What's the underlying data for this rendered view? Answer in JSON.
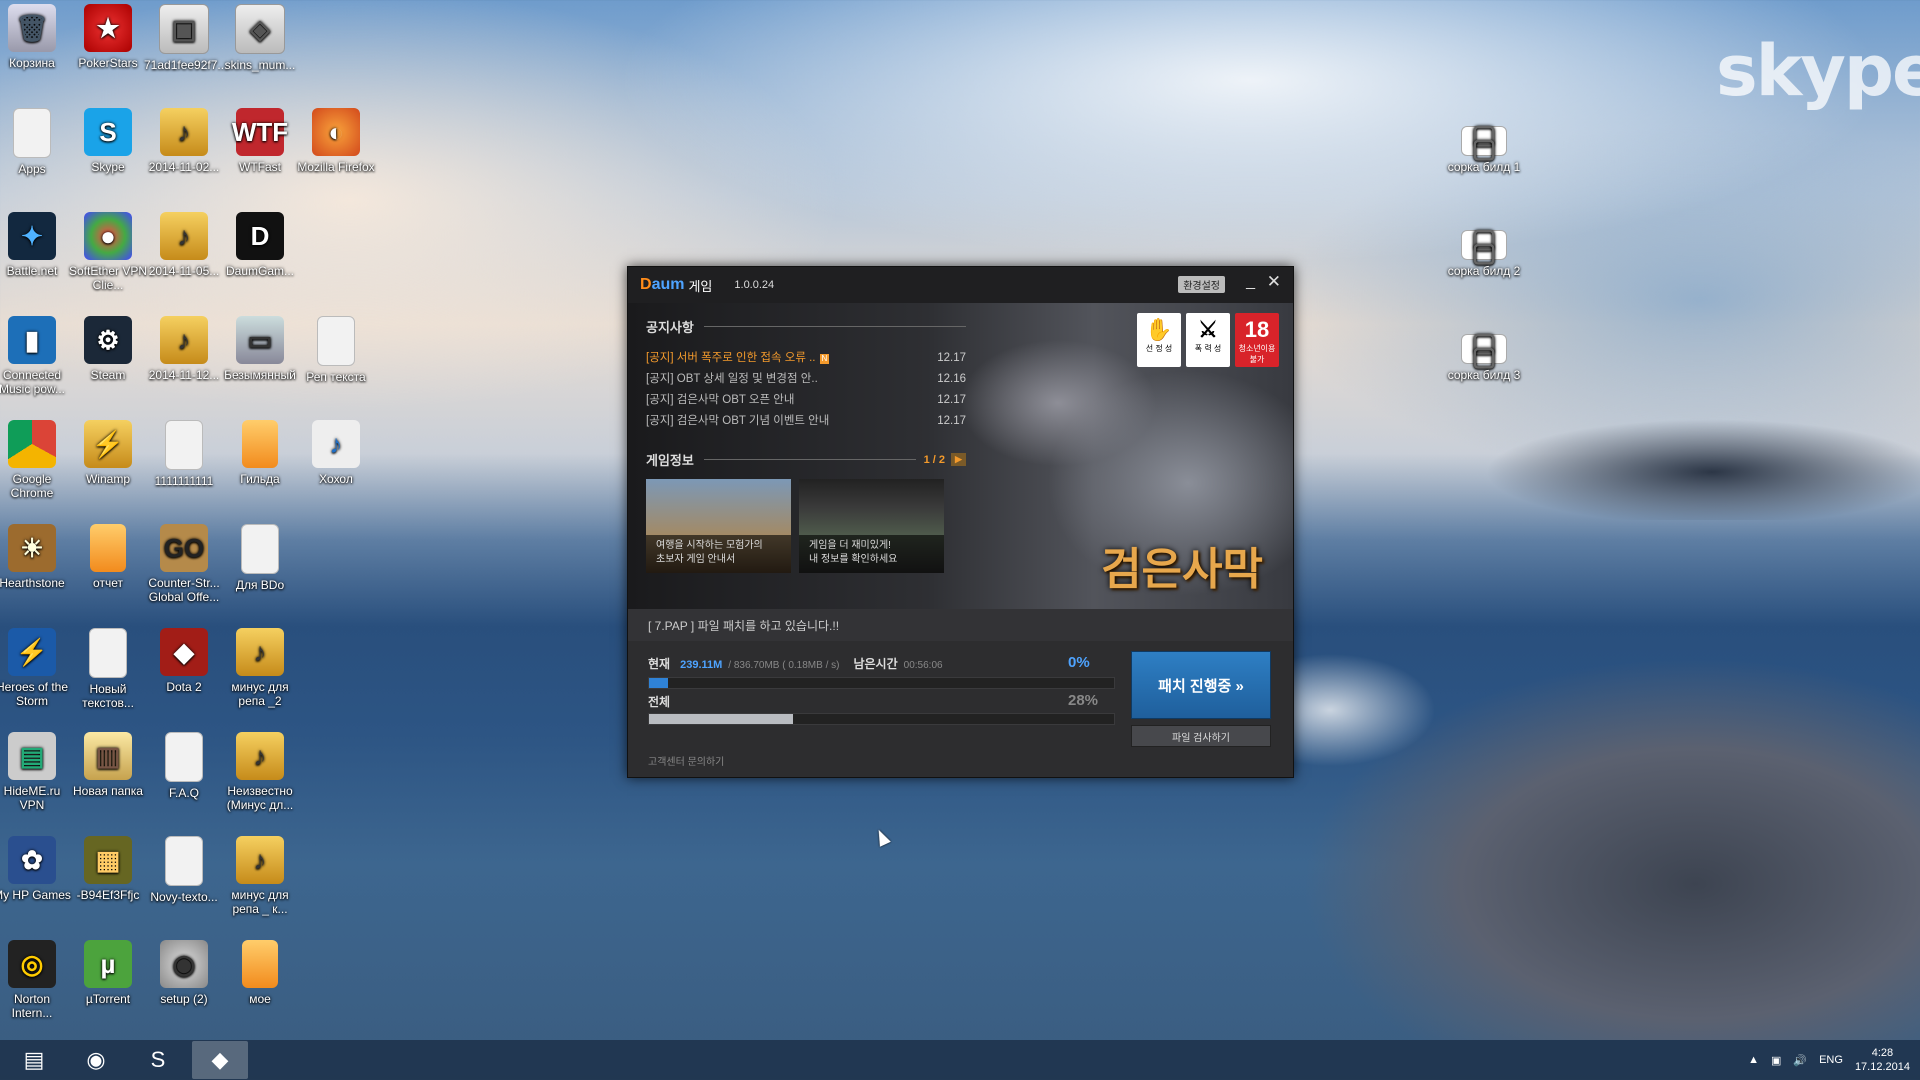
{
  "desktop": {
    "icons": [
      {
        "label": "Корзина",
        "glyph": "🗑",
        "cls": "g-bin",
        "name": "recycle-bin-icon"
      },
      {
        "label": "PokerStars",
        "glyph": "★",
        "cls": "g-star",
        "name": "pokerstars-icon"
      },
      {
        "label": "71ad1fee92f7...",
        "glyph": "▣",
        "cls": "g-img",
        "name": "image-file-icon"
      },
      {
        "label": "skins_mum...",
        "glyph": "◈",
        "cls": "g-img",
        "name": "skins-file-icon"
      },
      {
        "label": "Apps",
        "glyph": "",
        "cls": "g-doc",
        "name": "apps-shortcut-icon"
      },
      {
        "label": "Skype",
        "glyph": "S",
        "cls": "g-skype",
        "name": "skype-icon"
      },
      {
        "label": "2014-11-02...",
        "glyph": "♪",
        "cls": "g-winamp",
        "name": "winamp-file-icon"
      },
      {
        "label": "WTFast",
        "glyph": "WTF",
        "cls": "g-wtf",
        "name": "wtfast-icon"
      },
      {
        "label": "Mozilla Firefox",
        "glyph": "◐",
        "cls": "g-ff",
        "name": "firefox-icon"
      },
      {
        "label": "Battle.net",
        "glyph": "✦",
        "cls": "g-bnet",
        "name": "battlenet-icon"
      },
      {
        "label": "SoftEther VPN Clie...",
        "glyph": "●",
        "cls": "g-se",
        "name": "softether-icon"
      },
      {
        "label": "2014-11-05...",
        "glyph": "♪",
        "cls": "g-winamp",
        "name": "winamp-file-icon"
      },
      {
        "label": "DaumGam...",
        "glyph": "D",
        "cls": "g-daum",
        "name": "daumgame-icon"
      },
      {
        "label": "Connected Music pow...",
        "glyph": "▮",
        "cls": "g-cm",
        "name": "connected-music-icon"
      },
      {
        "label": "Steam",
        "glyph": "⚙",
        "cls": "g-steam",
        "name": "steam-icon"
      },
      {
        "label": "2014-11-12...",
        "glyph": "♪",
        "cls": "g-winamp",
        "name": "winamp-file-icon"
      },
      {
        "label": "Безымянный",
        "glyph": "▭",
        "cls": "g-pic",
        "name": "picture-file-icon"
      },
      {
        "label": "Реп текста",
        "glyph": "",
        "cls": "g-doc",
        "name": "text-file-icon"
      },
      {
        "label": "Google Chrome",
        "glyph": "",
        "cls": "g-chrome",
        "name": "chrome-icon"
      },
      {
        "label": "Winamp",
        "glyph": "⚡",
        "cls": "g-winamp",
        "name": "winamp-icon"
      },
      {
        "label": "1111111111",
        "glyph": "",
        "cls": "g-doc",
        "name": "text-file-icon"
      },
      {
        "label": "Гильда",
        "glyph": "",
        "cls": "g-folder",
        "name": "archive-file-icon"
      },
      {
        "label": "Хохол",
        "glyph": "♪",
        "cls": "g-note",
        "name": "audio-file-icon"
      },
      {
        "label": "Hearthstone",
        "glyph": "☀",
        "cls": "g-hs",
        "name": "hearthstone-icon"
      },
      {
        "label": "отчет",
        "glyph": "",
        "cls": "g-folder",
        "name": "archive-file-icon"
      },
      {
        "label": "Counter-Str... Global Offe...",
        "glyph": "GO",
        "cls": "g-cs",
        "name": "csgo-icon"
      },
      {
        "label": "Для BDo",
        "glyph": "",
        "cls": "g-doc",
        "name": "text-file-icon"
      },
      {
        "label": "Heroes of the Storm",
        "glyph": "⚡",
        "cls": "g-hots",
        "name": "heroes-of-the-storm-icon"
      },
      {
        "label": "Новый текстов...",
        "glyph": "",
        "cls": "g-doc",
        "name": "text-file-icon"
      },
      {
        "label": "Dota 2",
        "glyph": "◆",
        "cls": "g-dota",
        "name": "dota2-icon"
      },
      {
        "label": "минус для репа _2",
        "glyph": "♪",
        "cls": "g-winamp",
        "name": "winamp-file-icon"
      },
      {
        "label": "HideME.ru VPN",
        "glyph": "▤",
        "cls": "g-hide",
        "name": "hideme-vpn-icon"
      },
      {
        "label": "Новая папка",
        "glyph": "▥",
        "cls": "g-newf",
        "name": "folder-icon"
      },
      {
        "label": "F.A.Q",
        "glyph": "",
        "cls": "g-doc",
        "name": "text-file-icon"
      },
      {
        "label": "Неизвестно (Минус дл...",
        "glyph": "♪",
        "cls": "g-winamp",
        "name": "winamp-file-icon"
      },
      {
        "label": "My HP Games",
        "glyph": "✿",
        "cls": "g-hp",
        "name": "hp-games-icon"
      },
      {
        "label": "-B94Ef3Ffjc",
        "glyph": "▦",
        "cls": "g-rar",
        "name": "archive-icon"
      },
      {
        "label": "Novy-texto...",
        "glyph": "",
        "cls": "g-doc",
        "name": "text-file-icon"
      },
      {
        "label": "минус для репа _ к...",
        "glyph": "♪",
        "cls": "g-winamp",
        "name": "winamp-file-icon"
      },
      {
        "label": "Norton Intern...",
        "glyph": "◎",
        "cls": "g-norton",
        "name": "norton-icon"
      },
      {
        "label": "µTorrent",
        "glyph": "µ",
        "cls": "g-ut",
        "name": "utorrent-icon"
      },
      {
        "label": "setup (2)",
        "glyph": "◉",
        "cls": "g-cd",
        "name": "setup-disc-icon"
      },
      {
        "label": "мое",
        "glyph": "",
        "cls": "g-folder",
        "name": "archive-file-icon"
      },
      {
        "label": "сорка билд 1",
        "glyph": "▢ ▢",
        "cls": "g-qr",
        "name": "image-file-icon"
      },
      {
        "label": "сорка билд 2",
        "glyph": "▢ ▢",
        "cls": "g-qr",
        "name": "image-file-icon"
      },
      {
        "label": "сорка билд 3",
        "glyph": "▢ ▢",
        "cls": "g-qr",
        "name": "image-file-icon"
      }
    ],
    "skype_watermark": "skype"
  },
  "launcher": {
    "logo": {
      "part1": "D",
      "part2": "aum"
    },
    "app_name": "게임",
    "version": "1.0.0.24",
    "settings_label": "환경설정",
    "minimize_glyph": "_",
    "close_glyph": "✕",
    "notice_title": "공지사항",
    "notices": [
      {
        "text": "[공지] 서버 폭주로 인한 접속 오류 ..",
        "date": "12.17",
        "highlight": true,
        "new": "N"
      },
      {
        "text": "[공지] OBT 상세 일정 및 변경점 안..",
        "date": "12.16",
        "highlight": false,
        "new": ""
      },
      {
        "text": "[공지] 검은사막 OBT 오픈 안내",
        "date": "12.17",
        "highlight": false,
        "new": ""
      },
      {
        "text": "[공지] 검은사막 OBT 기념 이벤트 안내",
        "date": "12.17",
        "highlight": false,
        "new": ""
      }
    ],
    "game_info_title": "게임정보",
    "pager": "1 / 2",
    "pager_next": "▶",
    "thumbs": [
      {
        "line1": "여행을 시작하는 모험가의",
        "line2": "초보자 게임 안내서"
      },
      {
        "line1": "게임을 더 재미있게!",
        "line2": "내 정보를 확인하세요"
      }
    ],
    "ratings": [
      {
        "glyph": "✋",
        "label": "선 정 성"
      },
      {
        "glyph": "⚔",
        "label": "폭 력 성"
      },
      {
        "glyph": "18",
        "label": "청소년이용불가"
      }
    ],
    "game_logo": "검은사막",
    "status_text": "[ 7.PAP ] 파일 패치를 하고 있습니다.!!",
    "current": {
      "label": "현재",
      "value": "239.11M",
      "detail": "/ 836.70MB ( 0.18MB / s)",
      "remaining_label": "남은시간",
      "remaining": "00:56:06",
      "percent_text": "0%",
      "fraction": 0.04
    },
    "total": {
      "label": "전체",
      "percent_text": "28%",
      "fraction": 0.31
    },
    "patch_button": "패치 진행중 »",
    "check_button": "파일 검사하기",
    "support_link": "고객센터 문의하기"
  },
  "taskbar": {
    "buttons": [
      {
        "glyph": "▤",
        "name": "file-explorer-icon",
        "active": false
      },
      {
        "glyph": "◉",
        "name": "chrome-taskbar-icon",
        "active": false
      },
      {
        "glyph": "S",
        "name": "skype-taskbar-icon",
        "active": false
      },
      {
        "glyph": "◆",
        "name": "black-desert-launcher-taskbar-icon",
        "active": true
      }
    ],
    "tray_arrow": "▲",
    "language": "ENG",
    "time": "4:28",
    "date": "17.12.2014",
    "volume_glyph": "🔊",
    "network_glyph": "▣"
  }
}
